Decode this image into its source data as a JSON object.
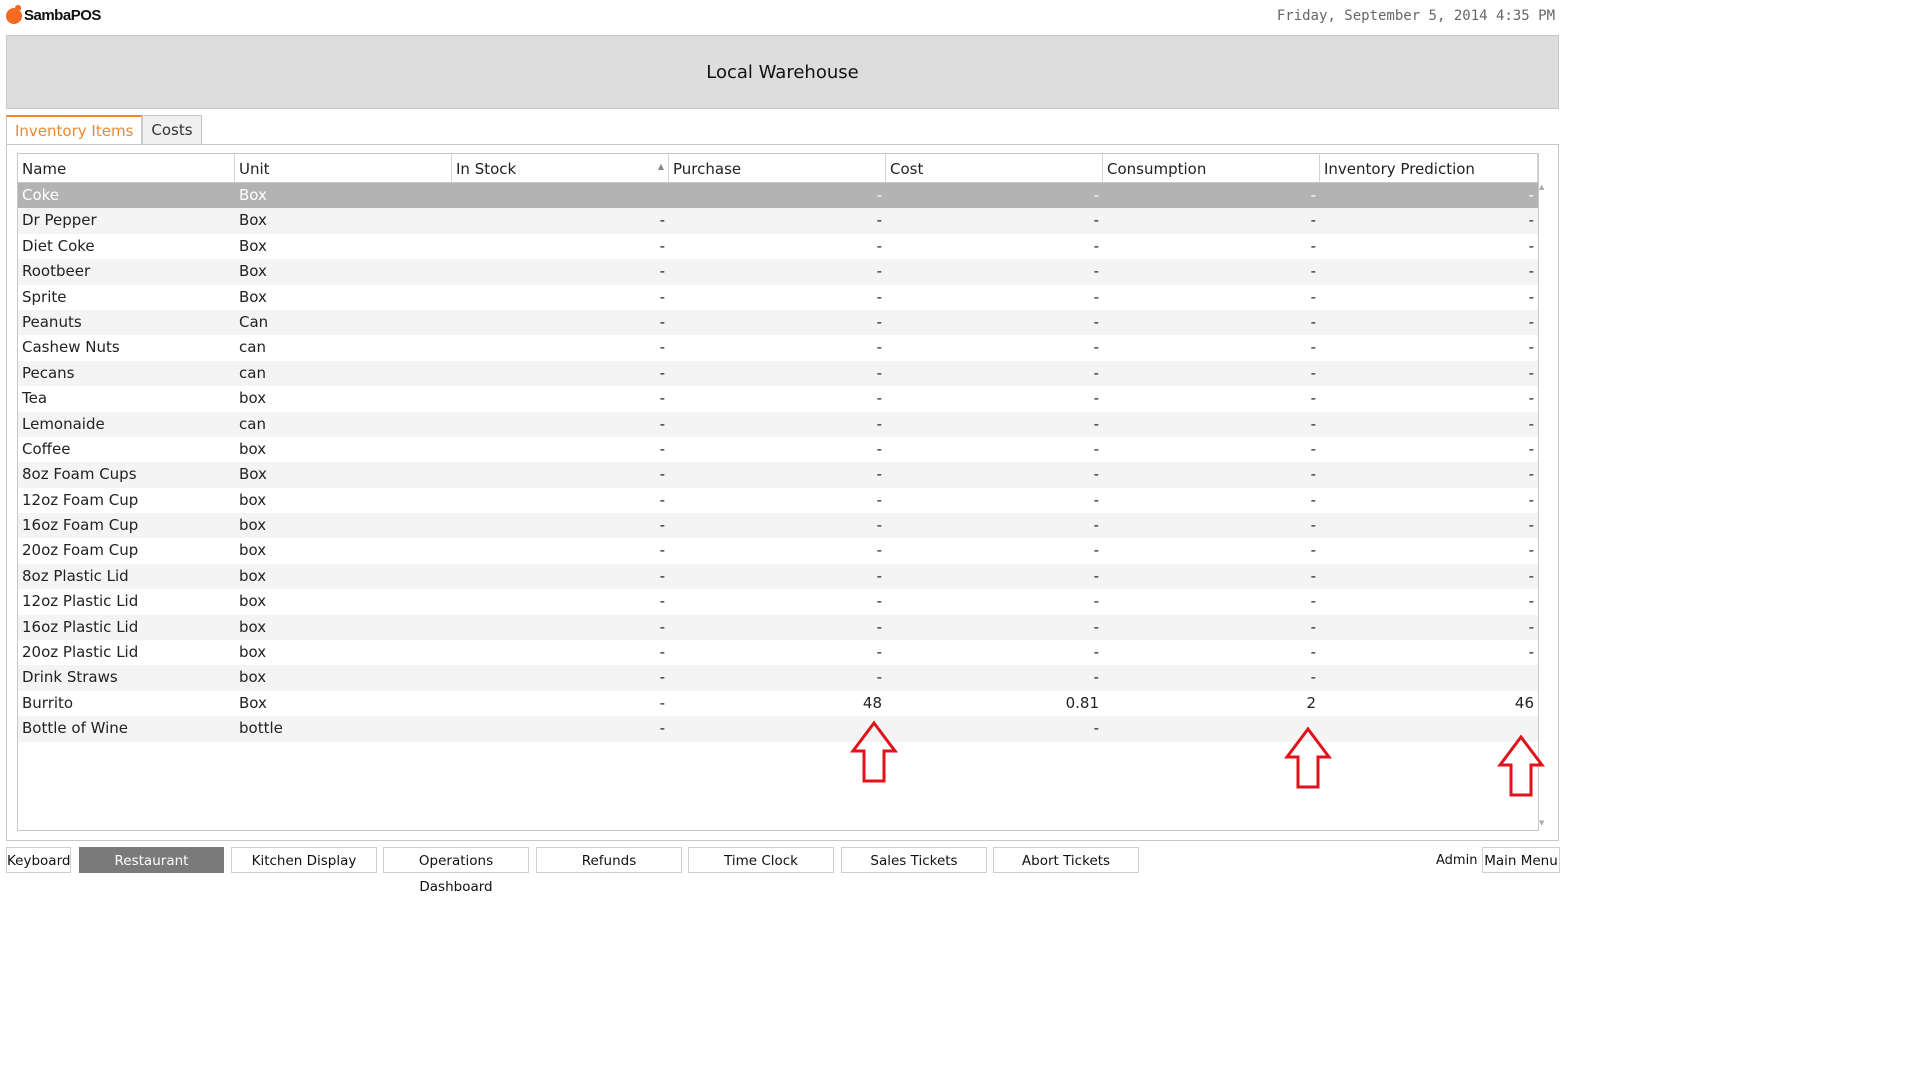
{
  "app": {
    "name": "SambaPOS",
    "datetime": "Friday, September 5, 2014 4:35 PM"
  },
  "header": {
    "title": "Local Warehouse"
  },
  "tabs": [
    {
      "label": "Inventory Items",
      "active": true
    },
    {
      "label": "Costs",
      "active": false
    }
  ],
  "grid": {
    "columns": [
      "Name",
      "Unit",
      "In Stock",
      "Purchase",
      "Cost",
      "Consumption",
      "Inventory Prediction"
    ],
    "sorted_column": "In Stock",
    "rows": [
      [
        "Coke",
        "Box",
        "",
        "-",
        "-",
        "-",
        "-"
      ],
      [
        "Dr Pepper",
        "Box",
        "-",
        "-",
        "-",
        "-",
        "-"
      ],
      [
        "Diet Coke",
        "Box",
        "-",
        "-",
        "-",
        "-",
        "-"
      ],
      [
        "Rootbeer",
        "Box",
        "-",
        "-",
        "-",
        "-",
        "-"
      ],
      [
        "Sprite",
        "Box",
        "-",
        "-",
        "-",
        "-",
        "-"
      ],
      [
        "Peanuts",
        "Can",
        "-",
        "-",
        "-",
        "-",
        "-"
      ],
      [
        "Cashew Nuts",
        "can",
        "-",
        "-",
        "-",
        "-",
        "-"
      ],
      [
        "Pecans",
        "can",
        "-",
        "-",
        "-",
        "-",
        "-"
      ],
      [
        "Tea",
        "box",
        "-",
        "-",
        "-",
        "-",
        "-"
      ],
      [
        "Lemonaide",
        "can",
        "-",
        "-",
        "-",
        "-",
        "-"
      ],
      [
        "Coffee",
        "box",
        "-",
        "-",
        "-",
        "-",
        "-"
      ],
      [
        "8oz Foam Cups",
        "Box",
        "-",
        "-",
        "-",
        "-",
        "-"
      ],
      [
        "12oz Foam Cup",
        "box",
        "-",
        "-",
        "-",
        "-",
        "-"
      ],
      [
        "16oz Foam Cup",
        "box",
        "-",
        "-",
        "-",
        "-",
        "-"
      ],
      [
        "20oz Foam Cup",
        "box",
        "-",
        "-",
        "-",
        "-",
        "-"
      ],
      [
        "8oz Plastic Lid",
        "box",
        "-",
        "-",
        "-",
        "-",
        "-"
      ],
      [
        "12oz Plastic Lid",
        "box",
        "-",
        "-",
        "-",
        "-",
        "-"
      ],
      [
        "16oz Plastic Lid",
        "box",
        "-",
        "-",
        "-",
        "-",
        "-"
      ],
      [
        "20oz Plastic Lid",
        "box",
        "-",
        "-",
        "-",
        "-",
        "-"
      ],
      [
        "Drink Straws",
        "box",
        "-",
        "-",
        "-",
        "-",
        ""
      ],
      [
        "Burrito",
        "Box",
        "-",
        "48",
        "0.81",
        "2",
        "46"
      ],
      [
        "Bottle of Wine",
        "bottle",
        "-",
        "",
        "-",
        "",
        ""
      ]
    ]
  },
  "annotation_color": "#e0121a",
  "footer": {
    "buttons": [
      {
        "label": "Keyboard",
        "active": false
      },
      {
        "label": "Restaurant",
        "active": true
      },
      {
        "label": "Kitchen Display",
        "active": false
      },
      {
        "label": "Operations Dashboard",
        "active": false
      },
      {
        "label": "Refunds",
        "active": false
      },
      {
        "label": "Time Clock",
        "active": false
      },
      {
        "label": "Sales Tickets",
        "active": false
      },
      {
        "label": "Abort Tickets",
        "active": false
      }
    ],
    "user": "Admin",
    "main_menu": "Main Menu"
  }
}
